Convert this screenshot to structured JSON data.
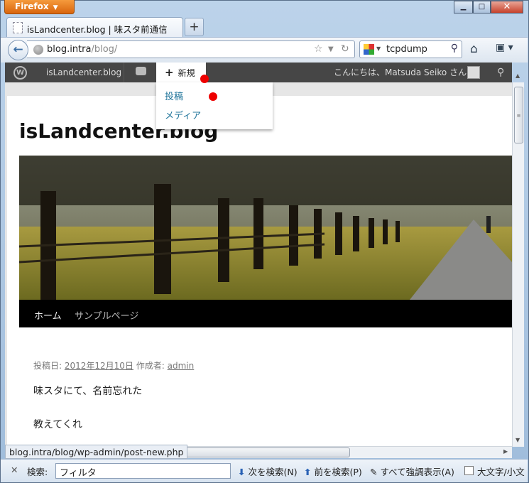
{
  "browser": {
    "menu_label": "Firefox",
    "tab_title": "isLandcenter.blog | 味スタ前通信",
    "new_tab_label": "+",
    "url_host": "blog.intra",
    "url_path": "/blog/",
    "search_text": "tcpdump"
  },
  "wp_admin_bar": {
    "site_name": "isLandcenter.blog",
    "new_label": "新規",
    "greeting": "こんにちは、Matsuda Seiko さん !",
    "dropdown": [
      "投稿",
      "メディア"
    ]
  },
  "page": {
    "site_title": "isLandcenter.blog",
    "menu": [
      "ホーム",
      "サンプルページ"
    ],
    "meta_prefix": "投稿日: ",
    "meta_date": "2012年12月10日",
    "meta_author_prefix": " 作成者: ",
    "meta_author": "admin",
    "body": [
      "味スタにて、名前忘れた",
      "教えてくれ"
    ]
  },
  "status_bar": {
    "url": "blog.intra/blog/wp-admin/post-new.php"
  },
  "find_bar": {
    "label": "検索:",
    "value": "フィルタ",
    "next": "次を検索(N)",
    "prev": "前を検索(P)",
    "highlight": "すべて強調表示(A)",
    "match_case": "大文字/小文"
  },
  "colors": {
    "wp_bar": "#464646",
    "link": "#21759b",
    "firefox_button": "#e8781a",
    "marker": "#ee0000"
  }
}
